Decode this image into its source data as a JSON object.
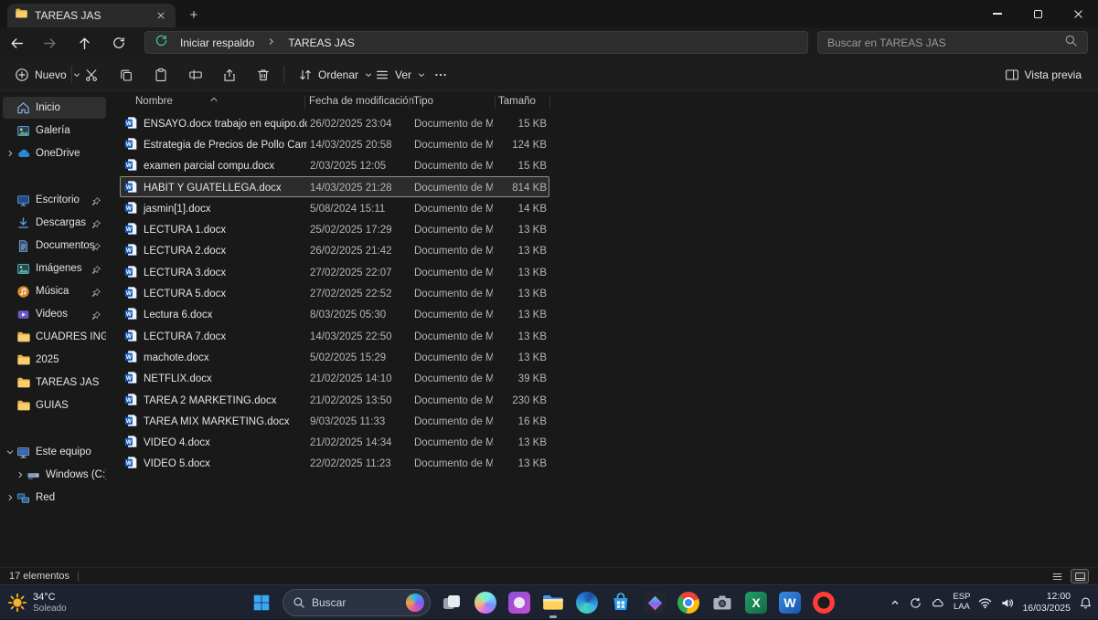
{
  "window": {
    "tab_title": "TAREAS JAS",
    "new_tab": "+"
  },
  "nav": {
    "breadcrumb_root": "Iniciar respaldo",
    "breadcrumb_current": "TAREAS JAS",
    "search_placeholder": "Buscar en TAREAS JAS"
  },
  "toolbar": {
    "new_label": "Nuevo",
    "sort_label": "Ordenar",
    "view_label": "Ver",
    "preview_label": "Vista previa"
  },
  "sidebar": {
    "items": [
      {
        "label": "Inicio",
        "icon": "home-icon",
        "selected": true
      },
      {
        "label": "Galería",
        "icon": "gallery-icon"
      },
      {
        "label": "OneDrive",
        "icon": "onedrive-icon",
        "expander": "right"
      },
      {
        "separator": true
      },
      {
        "label": "Escritorio",
        "icon": "desktop-icon",
        "pinned": true
      },
      {
        "label": "Descargas",
        "icon": "downloads-icon",
        "pinned": true
      },
      {
        "label": "Documentos",
        "icon": "documents-icon",
        "pinned": true
      },
      {
        "label": "Imágenes",
        "icon": "pictures-icon",
        "pinned": true
      },
      {
        "label": "Música",
        "icon": "music-icon",
        "pinned": true
      },
      {
        "label": "Videos",
        "icon": "videos-icon",
        "pinned": true
      },
      {
        "label": "CUADRES INGRESO",
        "icon": "folder-icon"
      },
      {
        "label": "2025",
        "icon": "folder-icon"
      },
      {
        "label": "TAREAS JAS",
        "icon": "folder-icon"
      },
      {
        "label": "GUIAS",
        "icon": "folder-icon"
      },
      {
        "separator": true
      },
      {
        "label": "Este equipo",
        "icon": "computer-icon",
        "expander": "down"
      },
      {
        "label": "Windows (C:)",
        "icon": "drive-icon",
        "expander": "right",
        "indent": true
      },
      {
        "label": "Red",
        "icon": "network-icon",
        "expander": "right"
      }
    ]
  },
  "files": {
    "columns": {
      "name": "Nombre",
      "date": "Fecha de modificación",
      "type": "Tipo",
      "size": "Tamaño"
    },
    "rows": [
      {
        "name": "ENSAYO.docx trabajo en equipo.docx",
        "date": "26/02/2025 23:04",
        "type": "Documento de Mi...",
        "size": "15 KB"
      },
      {
        "name": "Estrategia de Precios de Pollo Campero.d...",
        "date": "14/03/2025 20:58",
        "type": "Documento de Mi...",
        "size": "124 KB"
      },
      {
        "name": "examen parcial compu.docx",
        "date": "2/03/2025 12:05",
        "type": "Documento de Mi...",
        "size": "15 KB"
      },
      {
        "name": "HABIT Y GUATELLEGA.docx",
        "date": "14/03/2025 21:28",
        "type": "Documento de Mi...",
        "size": "814 KB",
        "selected": true
      },
      {
        "name": "jasmin[1].docx",
        "date": "5/08/2024 15:11",
        "type": "Documento de Mi...",
        "size": "14 KB"
      },
      {
        "name": "LECTURA 1.docx",
        "date": "25/02/2025 17:29",
        "type": "Documento de Mi...",
        "size": "13 KB"
      },
      {
        "name": "LECTURA 2.docx",
        "date": "26/02/2025 21:42",
        "type": "Documento de Mi...",
        "size": "13 KB"
      },
      {
        "name": "LECTURA 3.docx",
        "date": "27/02/2025 22:07",
        "type": "Documento de Mi...",
        "size": "13 KB"
      },
      {
        "name": "LECTURA 5.docx",
        "date": "27/02/2025 22:52",
        "type": "Documento de Mi...",
        "size": "13 KB"
      },
      {
        "name": "Lectura 6.docx",
        "date": "8/03/2025 05:30",
        "type": "Documento de Mi...",
        "size": "13 KB"
      },
      {
        "name": "LECTURA 7.docx",
        "date": "14/03/2025 22:50",
        "type": "Documento de Mi...",
        "size": "13 KB"
      },
      {
        "name": "machote.docx",
        "date": "5/02/2025 15:29",
        "type": "Documento de Mi...",
        "size": "13 KB"
      },
      {
        "name": "NETFLIX.docx",
        "date": "21/02/2025 14:10",
        "type": "Documento de Mi...",
        "size": "39 KB"
      },
      {
        "name": "TAREA 2 MARKETING.docx",
        "date": "21/02/2025 13:50",
        "type": "Documento de Mi...",
        "size": "230 KB"
      },
      {
        "name": "TAREA MIX MARKETING.docx",
        "date": "9/03/2025 11:33",
        "type": "Documento de Mi...",
        "size": "16 KB"
      },
      {
        "name": "VIDEO 4.docx",
        "date": "21/02/2025 14:34",
        "type": "Documento de Mi...",
        "size": "13 KB"
      },
      {
        "name": "VIDEO 5.docx",
        "date": "22/02/2025 11:23",
        "type": "Documento de Mi...",
        "size": "13 KB"
      }
    ]
  },
  "status": {
    "count": "17 elementos",
    "divider": "|"
  },
  "taskbar": {
    "weather_temp": "34°C",
    "weather_cond": "Soleado",
    "search_label": "Buscar",
    "apps": [
      "task-view",
      "copilot",
      "paint",
      "file-explorer",
      "edge",
      "store",
      "media-app",
      "chrome",
      "camera",
      "excel",
      "word",
      "opera"
    ],
    "lang_top": "ESP",
    "lang_bottom": "LAA",
    "time": "12:00",
    "date": "16/03/2025"
  }
}
